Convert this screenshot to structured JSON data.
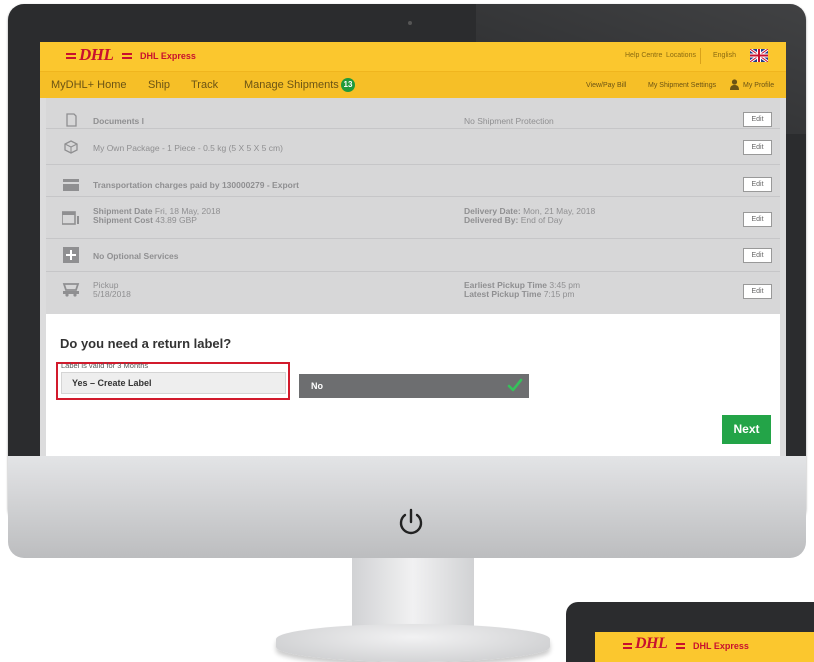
{
  "topbar": {
    "logo_text": "DHL",
    "brand_sub": "DHL Express",
    "links": [
      "Help Centre",
      "Locations",
      "English"
    ],
    "flag": "uk-flag-icon"
  },
  "nav": {
    "items": [
      "MyDHL+ Home",
      "Ship",
      "Track",
      "Manage Shipments"
    ],
    "badge_count": "13",
    "right_items": [
      "View/Pay Bill",
      "My Shipment Settings",
      "My Profile"
    ]
  },
  "summary": {
    "row1": {
      "icon": "document-icon",
      "left": "Documents l",
      "right": "No Shipment Protection",
      "edit": "Edit"
    },
    "row2": {
      "icon": "package-icon",
      "left": "My Own Package - 1 Piece - 0.5 kg (5 X 5 X 5 cm)",
      "edit": "Edit"
    },
    "row3": {
      "icon": "payment-icon",
      "left": "Transportation charges paid by 130000279 - Export",
      "edit": "Edit"
    },
    "row4": {
      "icon": "calendar-icon",
      "left_line1_label": "Shipment Date",
      "left_line1_value": "Fri, 18 May, 2018",
      "left_line2_label": "Shipment Cost",
      "left_line2_value": "43.89 GBP",
      "right_line1_label": "Delivery Date:",
      "right_line1_value": "Mon, 21 May, 2018",
      "right_line2_label": "Delivered By:",
      "right_line2_value": "End of Day",
      "edit": "Edit"
    },
    "row5": {
      "icon": "plus-icon",
      "left": "No Optional Services",
      "edit": "Edit"
    },
    "row6": {
      "icon": "truck-icon",
      "left_line1": "Pickup",
      "left_line2": "5/18/2018",
      "right_line1_label": "Earliest Pickup Time",
      "right_line1_value": "3:45 pm",
      "right_line2_label": "Latest Pickup Time",
      "right_line2_value": "7:15 pm",
      "edit": "Edit"
    }
  },
  "return_label": {
    "question": "Do you need a return label?",
    "validity": "Label is valid for 3 Months",
    "yes_label": "Yes – Create Label",
    "no_label": "No",
    "next_label": "Next"
  },
  "second_device": {
    "logo_text": "DHL",
    "brand_sub": "DHL Express"
  },
  "colors": {
    "dhl_yellow": "#fbc72e",
    "dhl_red": "#c8102e",
    "next_green": "#23a448",
    "selection_red": "#d21a2c"
  }
}
